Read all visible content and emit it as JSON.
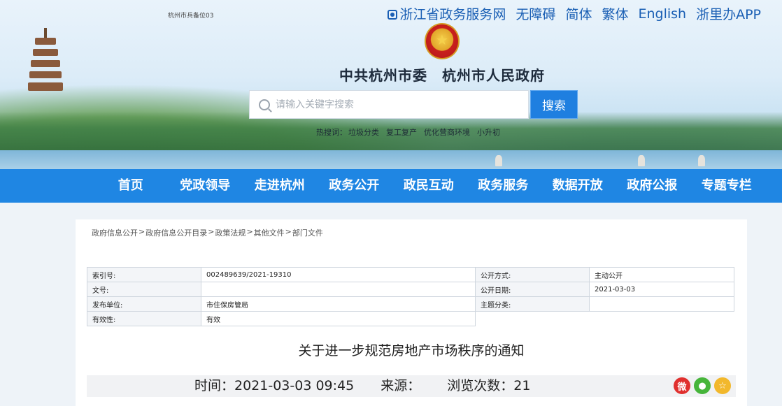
{
  "header": {
    "site_code": "杭州市兵备位03",
    "top_links": [
      {
        "label": "浙江省政务服务网",
        "icon": "zhejiang-icon"
      },
      {
        "label": "无障碍"
      },
      {
        "label": "简体"
      },
      {
        "label": "繁体"
      },
      {
        "label": "English"
      },
      {
        "label": "浙里办APP"
      }
    ],
    "title": "中共杭州市委　杭州市人民政府",
    "search": {
      "placeholder": "请输入关键字搜索",
      "button": "搜索"
    },
    "hotwords": [
      "热搜词：",
      "垃圾分类",
      "复工复产",
      "优化营商环境",
      "小升初"
    ]
  },
  "nav": {
    "items": [
      "首页",
      "党政领导",
      "走进杭州",
      "政务公开",
      "政民互动",
      "政务服务",
      "数据开放",
      "政府公报",
      "专题专栏"
    ]
  },
  "breadcrumb": [
    "政府信息公开",
    "政府信息公开目录",
    "政策法规",
    "其他文件",
    "部门文件"
  ],
  "breadcrumb_sep": ">",
  "meta": {
    "index_label": "索引号:",
    "index_value": "002489639/2021-19310",
    "method_label": "公开方式:",
    "method_value": "主动公开",
    "doc_no_label": "文号:",
    "doc_no_value": "",
    "date_label": "公开日期:",
    "date_value": "2021-03-03",
    "issuer_label": "发布单位:",
    "issuer_value": "市住保房管局",
    "topic_label": "主题分类:",
    "topic_value": "",
    "validity_label": "有效性:",
    "validity_value": "有效"
  },
  "doc": {
    "title": "关于进一步规范房地产市场秩序的通知",
    "time": "时间：2021-03-03 09:45",
    "source": "来源：",
    "views": "浏览次数：21"
  },
  "share": {
    "icons": [
      "weibo-icon",
      "wechat-icon",
      "favorite-icon"
    ],
    "colors": {
      "weibo": "#e0302e",
      "wechat": "#47b53b",
      "favorite": "#f2b82c"
    }
  },
  "colors": {
    "nav_bg": "#1f86e3",
    "search_btn": "#1f7fe0",
    "link": "#1a5fb4"
  }
}
